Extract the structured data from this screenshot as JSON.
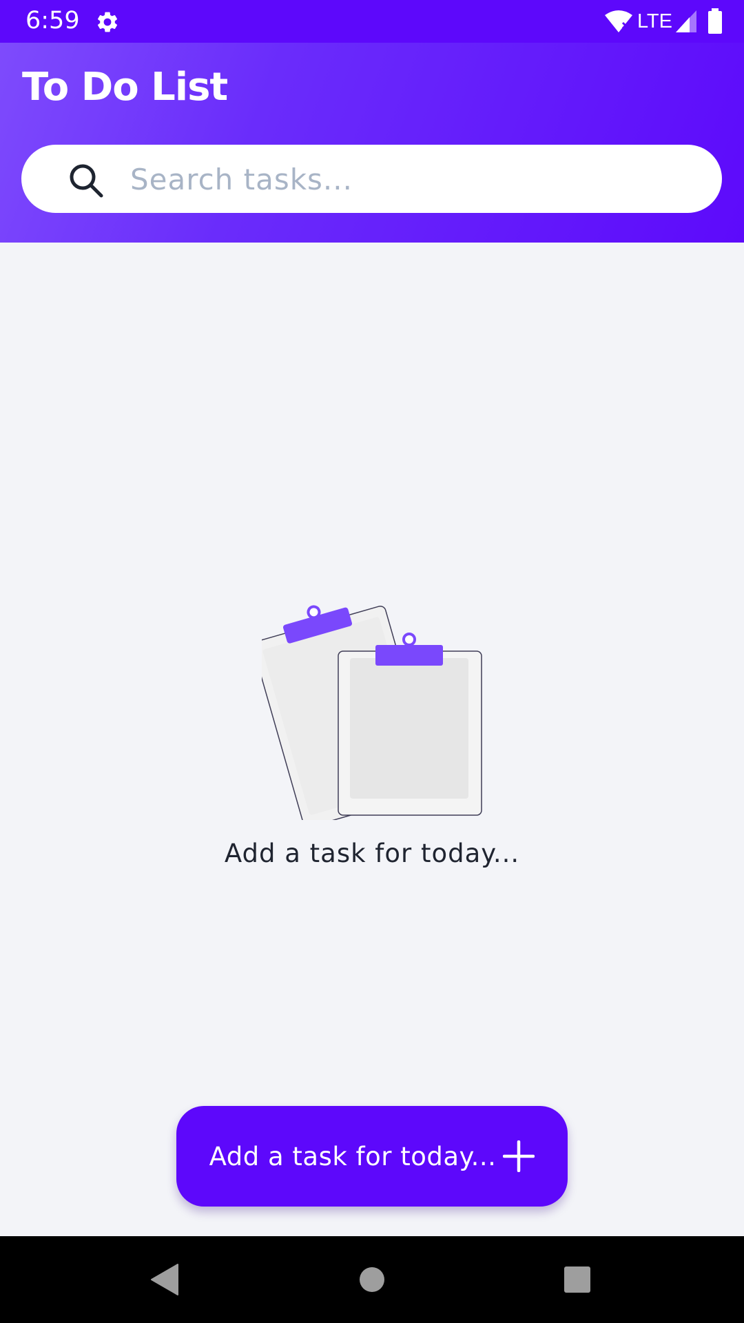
{
  "status_bar": {
    "time": "6:59",
    "network": "LTE",
    "icons": [
      "gear-icon",
      "wifi-icon",
      "signal-icon",
      "battery-icon"
    ]
  },
  "header": {
    "title": "To Do List"
  },
  "search": {
    "placeholder": "Search tasks...",
    "value": ""
  },
  "empty_state": {
    "message": "Add a task for today...",
    "illustration": "clipboards-illustration"
  },
  "add_button": {
    "label": "Add a task for today...",
    "icon": "plus-icon"
  },
  "nav_bar": {
    "buttons": [
      "back-icon",
      "home-icon",
      "recents-icon"
    ]
  },
  "colors": {
    "accent": "#5d08fb",
    "header_gradient_start": "#7e4bfc",
    "background": "#f3f4f8",
    "placeholder": "#a8b4c6",
    "text_dark": "#1f2430",
    "illustration_clip": "#7a48fc"
  }
}
